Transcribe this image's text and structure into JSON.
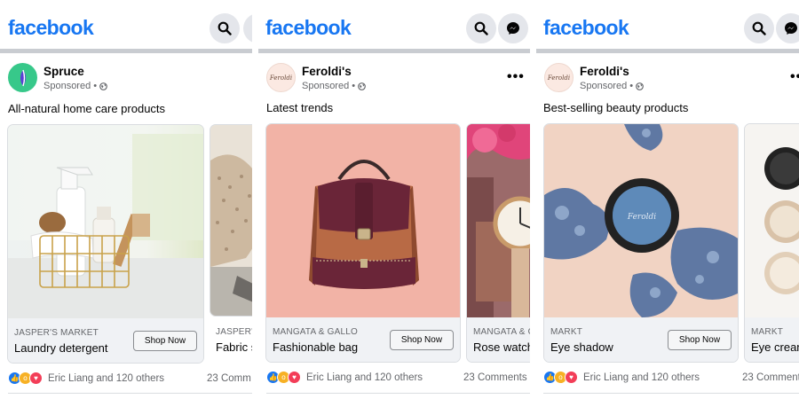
{
  "brand": "facebook",
  "panels": [
    {
      "page_name": "Spruce",
      "sponsored": "Sponsored •",
      "post_text": "All-natural home care products",
      "cards": [
        {
          "shop": "JASPER'S MARKET",
          "product": "Laundry detergent",
          "cta": "Shop Now"
        },
        {
          "shop": "JASPER'S",
          "product": "Fabric s"
        }
      ],
      "reactions_text": "Eric Liang and 120 others",
      "comments": "23 Comm"
    },
    {
      "page_name": "Feroldi's",
      "avatar_text": "Feroldi",
      "sponsored": "Sponsored •",
      "post_text": "Latest trends",
      "cards": [
        {
          "shop": "MANGATA & GALLO",
          "product": "Fashionable bag",
          "cta": "Shop Now"
        },
        {
          "shop": "MANGATA & G",
          "product": "Rose watch"
        }
      ],
      "reactions_text": "Eric Liang and 120 others",
      "comments": "23 Comments"
    },
    {
      "page_name": "Feroldi's",
      "avatar_text": "Feroldi",
      "sponsored": "Sponsored •",
      "post_text": "Best-selling beauty products",
      "cards": [
        {
          "shop": "MARKT",
          "product": "Eye shadow",
          "cta": "Shop Now"
        },
        {
          "shop": "MARKT",
          "product": "Eye crean"
        }
      ],
      "reactions_text": "Eric Liang and 120 others",
      "comments": "23 Comment"
    }
  ],
  "product_imprint": "Feroldi",
  "icons": {
    "search": "search-icon",
    "messenger": "messenger-icon",
    "globe": "globe-icon",
    "more": "more-icon",
    "like": "like-reaction-icon",
    "wow": "wow-reaction-icon",
    "love": "love-reaction-icon"
  },
  "colors": {
    "brand_blue": "#1877f2",
    "spruce_green": "#37c88a",
    "like_blue": "#1877f2",
    "wow_yellow": "#f7b125",
    "love_red": "#f33e58"
  }
}
